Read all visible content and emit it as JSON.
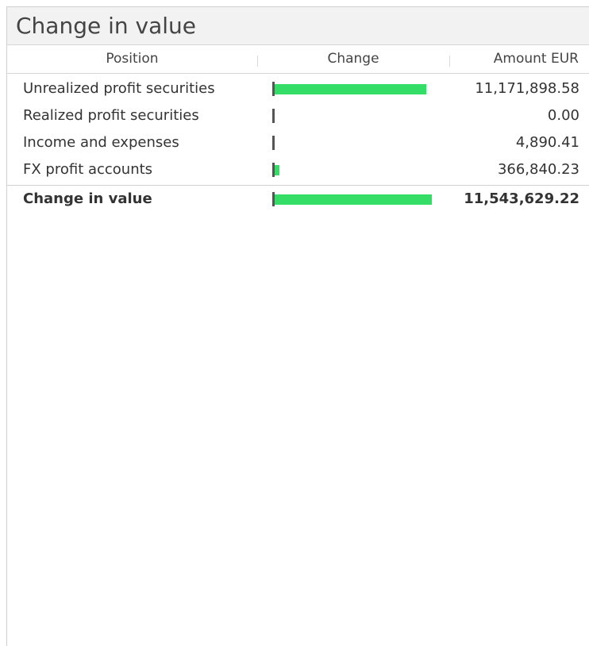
{
  "panel": {
    "title": "Change in value"
  },
  "table": {
    "columns": {
      "position": "Position",
      "change": "Change",
      "amount": "Amount EUR"
    },
    "rows": [
      {
        "label": "Unrealized profit securities",
        "amount": "11,171,898.58",
        "change_fraction": 0.965
      },
      {
        "label": "Realized profit securities",
        "amount": "0.00",
        "change_fraction": 0.0
      },
      {
        "label": "Income and expenses",
        "amount": "4,890.41",
        "change_fraction": 0.0004
      },
      {
        "label": "FX profit accounts",
        "amount": "366,840.23",
        "change_fraction": 0.032
      }
    ],
    "total": {
      "label": "Change in value",
      "amount": "11,543,629.22",
      "change_fraction": 1.0
    }
  },
  "colors": {
    "bar_positive": "#33dd66",
    "axis": "#555555"
  }
}
